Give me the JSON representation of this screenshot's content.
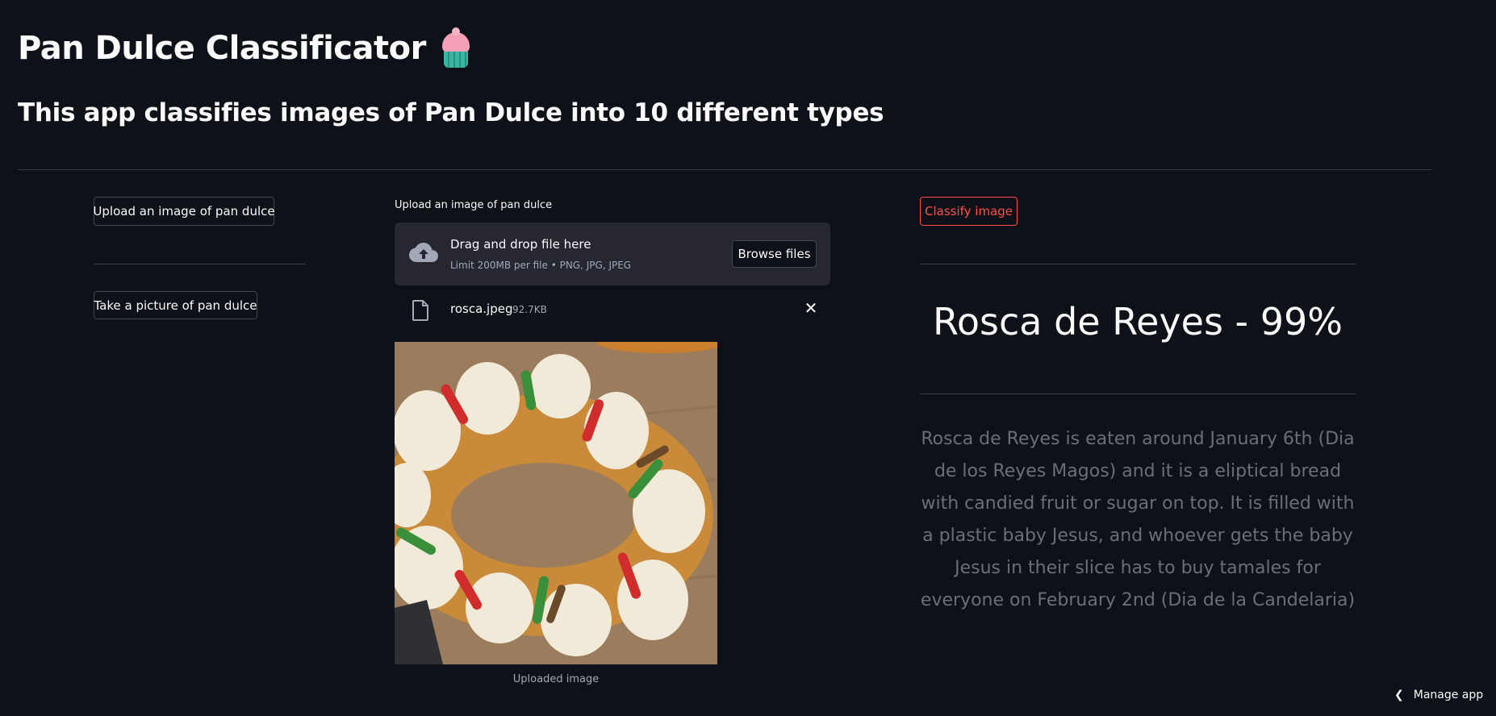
{
  "header": {
    "title": "Pan Dulce Classificator",
    "title_icon": "cupcake-icon",
    "subtitle": "This app classifies images of Pan Dulce into 10 different types"
  },
  "left_column": {
    "upload_button_label": "Upload an image of pan dulce",
    "picture_button_label": "Take a picture of pan dulce"
  },
  "uploader": {
    "label": "Upload an image of pan dulce",
    "drop_title": "Drag and drop file here",
    "drop_limit": "Limit 200MB per file • PNG, JPG, JPEG",
    "browse_label": "Browse files",
    "file_name": "rosca.jpeg",
    "file_size": "92.7KB",
    "image_caption": "Uploaded image"
  },
  "right_column": {
    "classify_label": "Classify image",
    "result": "Rosca de Reyes - 99%",
    "description": "Rosca de Reyes is eaten around January 6th (Dia de los Reyes Magos) and it is a eliptical bread with candied fruit or sugar on top. It is filled with a plastic baby Jesus, and whoever gets the baby Jesus in their slice has to buy tamales for everyone on February 2nd (Dia de la Candelaria)"
  },
  "footer": {
    "manage_label": "Manage app"
  },
  "colors": {
    "background": "#0e1117",
    "accent": "#ff4b4b",
    "panel": "#262730",
    "muted_text": "#6b6e78"
  }
}
